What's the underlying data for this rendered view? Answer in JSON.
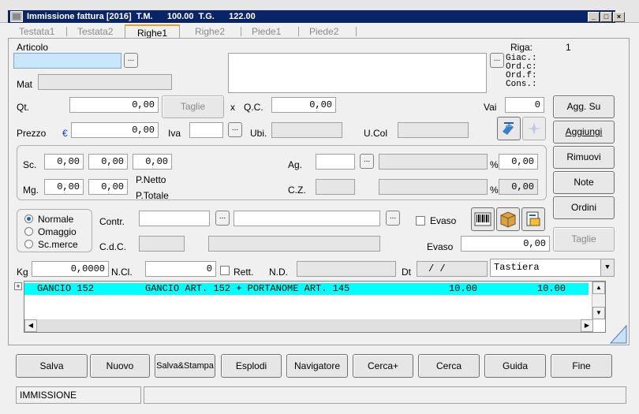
{
  "window": {
    "title": "Immissione fattura [2016]  T.M.      100.00  T.G.      122.00",
    "minimize": "_",
    "maximize": "□",
    "close": "×"
  },
  "tabs": [
    "Testata1",
    "Testata2",
    "Righe1",
    "Righe2",
    "Piede1",
    "Piede2"
  ],
  "active_tab": "Righe1",
  "form": {
    "articolo_label": "Articolo",
    "articolo_value": "",
    "mat_label": "Mat",
    "riga_label": "Riga:",
    "riga_value": "1",
    "stock_labels": [
      "Giac.:",
      "Ord.c:",
      "Ord.f:",
      "Cons.:"
    ],
    "qt_label": "Qt.",
    "qt_value": "0,00",
    "taglie_label": "Taglie",
    "x_label": "x",
    "qc_label": "Q.C.",
    "qc_value": "0,00",
    "vai_label": "Vai",
    "vai_value": "0",
    "prezzo_label": "Prezzo",
    "euro_symbol": "€",
    "prezzo_value": "0,00",
    "iva_label": "Iva",
    "ubi_label": "Ubi.",
    "ucol_label": "U.Col",
    "sc_label": "Sc.",
    "sc_values": [
      "0,00",
      "0,00",
      "0,00"
    ],
    "mg_label": "Mg.",
    "mg_values": [
      "0,00",
      "0,00"
    ],
    "pnetto_label": "P.Netto",
    "ptotale_label": "P.Totale",
    "ag_label": "Ag.",
    "ag_pct": "0,00",
    "cz_label": "C.Z.",
    "cz_pct": "0,00",
    "pct_symbol": "%",
    "radio_options": [
      "Normale",
      "Omaggio",
      "Sc.merce"
    ],
    "radio_selected": "Normale",
    "contr_label": "Contr.",
    "cdc_label": "C.d.C.",
    "evaso_check_label": "Evaso",
    "evaso_label": "Evaso",
    "evaso_value": "0,00",
    "kg_label": "Kg",
    "kg_value": "0,0000",
    "ncl_label": "N.Cl.",
    "ncl_value": "0",
    "rett_label": "Rett.",
    "nd_label": "N.D.",
    "dt_label": "Dt",
    "dt_value": "/ /",
    "tastiera_value": "Tastiera"
  },
  "side_buttons": {
    "agg_su": "Agg. Su",
    "aggiungi": "Aggiungi",
    "rimuovi": "Rimuovi",
    "note": "Note",
    "ordini": "Ordini",
    "taglie": "Taglie"
  },
  "grid": {
    "rows": [
      {
        "code": "GANCIO 152",
        "description": "GANCIO ART. 152 + PORTANOME ART. 145",
        "qty": "10.00",
        "amount": "10.00"
      }
    ]
  },
  "bottom_buttons": [
    "Salva",
    "Nuovo",
    "Salva&Stampa",
    "Esplodi",
    "Navigatore",
    "Cerca+",
    "Cerca",
    "Guida",
    "Fine"
  ],
  "status": {
    "mode": "IMMISSIONE",
    "message": ""
  },
  "colors": {
    "title_bar": "#0a246a",
    "grid_highlight": "#00ffff",
    "active_tab_accent": "#f0a020",
    "focused_field": "#c9e6fb"
  }
}
